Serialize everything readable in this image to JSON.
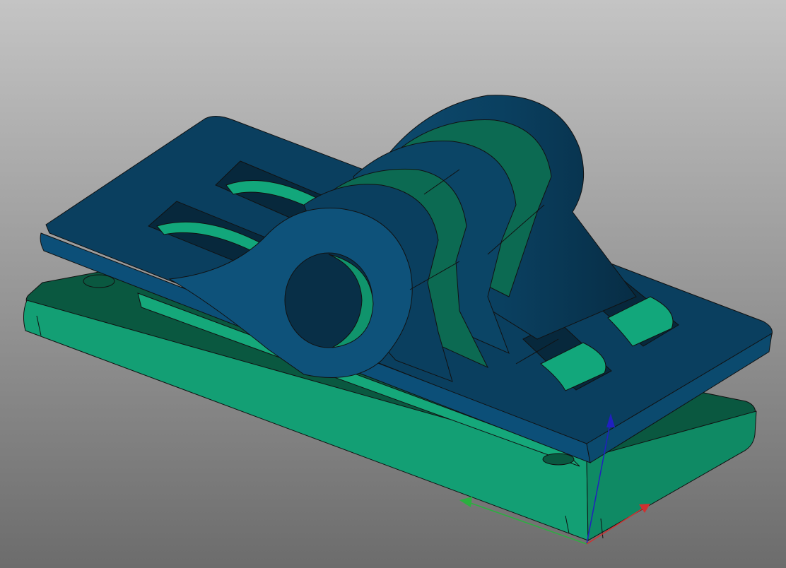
{
  "viewport": {
    "background_top": "#c4c4c4",
    "background_bottom": "#6c6c6c"
  },
  "model": {
    "colors": {
      "top_part_light": "#0e527a",
      "top_part_mid": "#0b4566",
      "top_part_dark": "#082f47",
      "bottom_part_light": "#139f74",
      "bottom_part_mid": "#0d7f5c",
      "bottom_part_dark": "#0a5840",
      "edge": "#111111"
    }
  },
  "axes": {
    "x_color": "#d03030",
    "y_color": "#2ab040",
    "z_color": "#2020c0"
  }
}
